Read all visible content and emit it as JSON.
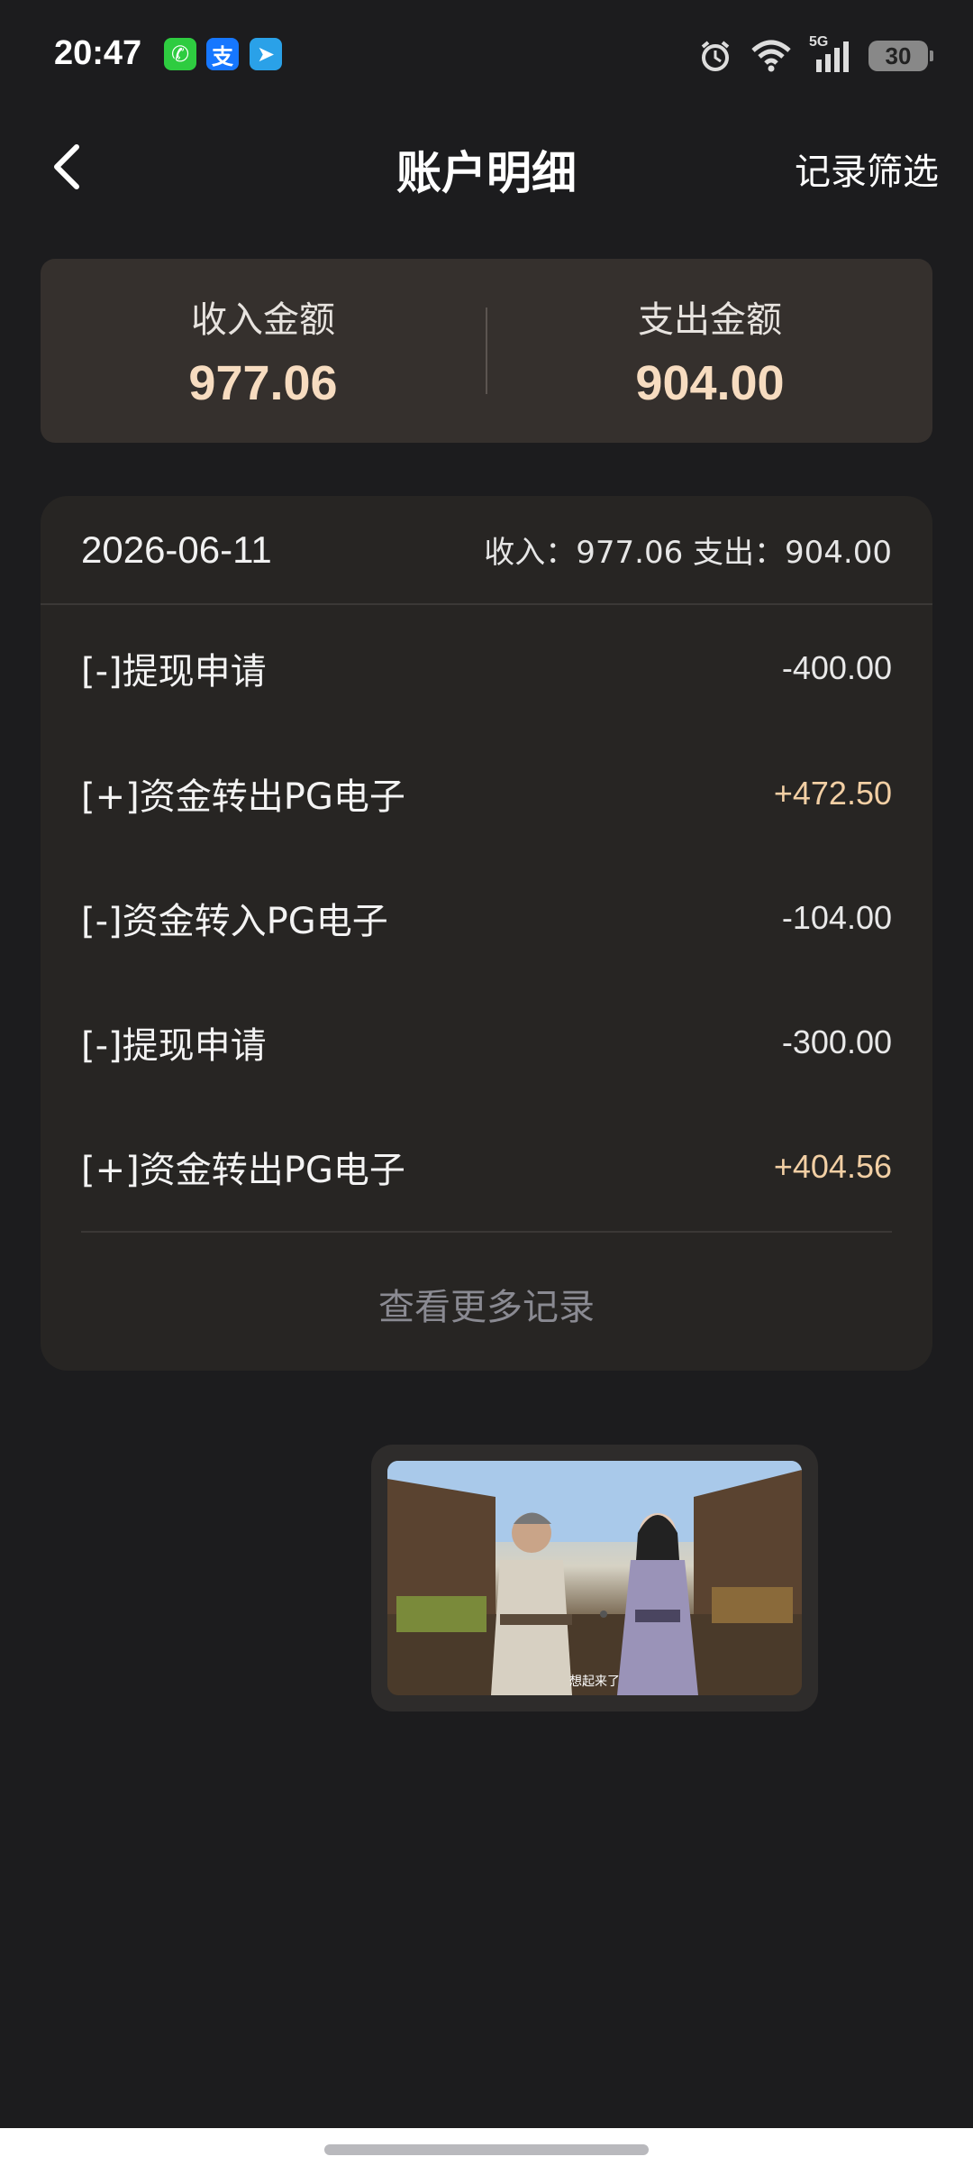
{
  "status_bar": {
    "time": "20:47",
    "apps": [
      {
        "icon": "phone-app-icon",
        "glyph": "✆"
      },
      {
        "icon": "alipay-app-icon",
        "glyph": "支"
      },
      {
        "icon": "send-app-icon",
        "glyph": "➤"
      }
    ],
    "network": "5G",
    "battery": "30"
  },
  "header": {
    "title": "账户明细",
    "filter_label": "记录筛选"
  },
  "summary": {
    "income_label": "收入金额",
    "income_value": "977.06",
    "expense_label": "支出金额",
    "expense_value": "904.00"
  },
  "records": {
    "date": "2026-06-11",
    "day_summary": "收入：977.06 支出：904.00",
    "items": [
      {
        "title": "[-]提现申请",
        "amount": "-400.00",
        "positive": false
      },
      {
        "title": "[+]资金转出PG电子",
        "amount": "+472.50",
        "positive": true
      },
      {
        "title": "[-]资金转入PG电子",
        "amount": "-104.00",
        "positive": false
      },
      {
        "title": "[-]提现申请",
        "amount": "-300.00",
        "positive": false
      },
      {
        "title": "[+]资金转出PG电子",
        "amount": "+404.56",
        "positive": true
      }
    ],
    "more_label": "查看更多记录"
  },
  "video": {
    "caption": "想起来了"
  },
  "colors": {
    "background": "#1c1c1e",
    "summary_card": "#35302d",
    "records_card": "#272523",
    "accent_amount": "#f7dcc0",
    "positive_amount": "#f2cfa4"
  }
}
